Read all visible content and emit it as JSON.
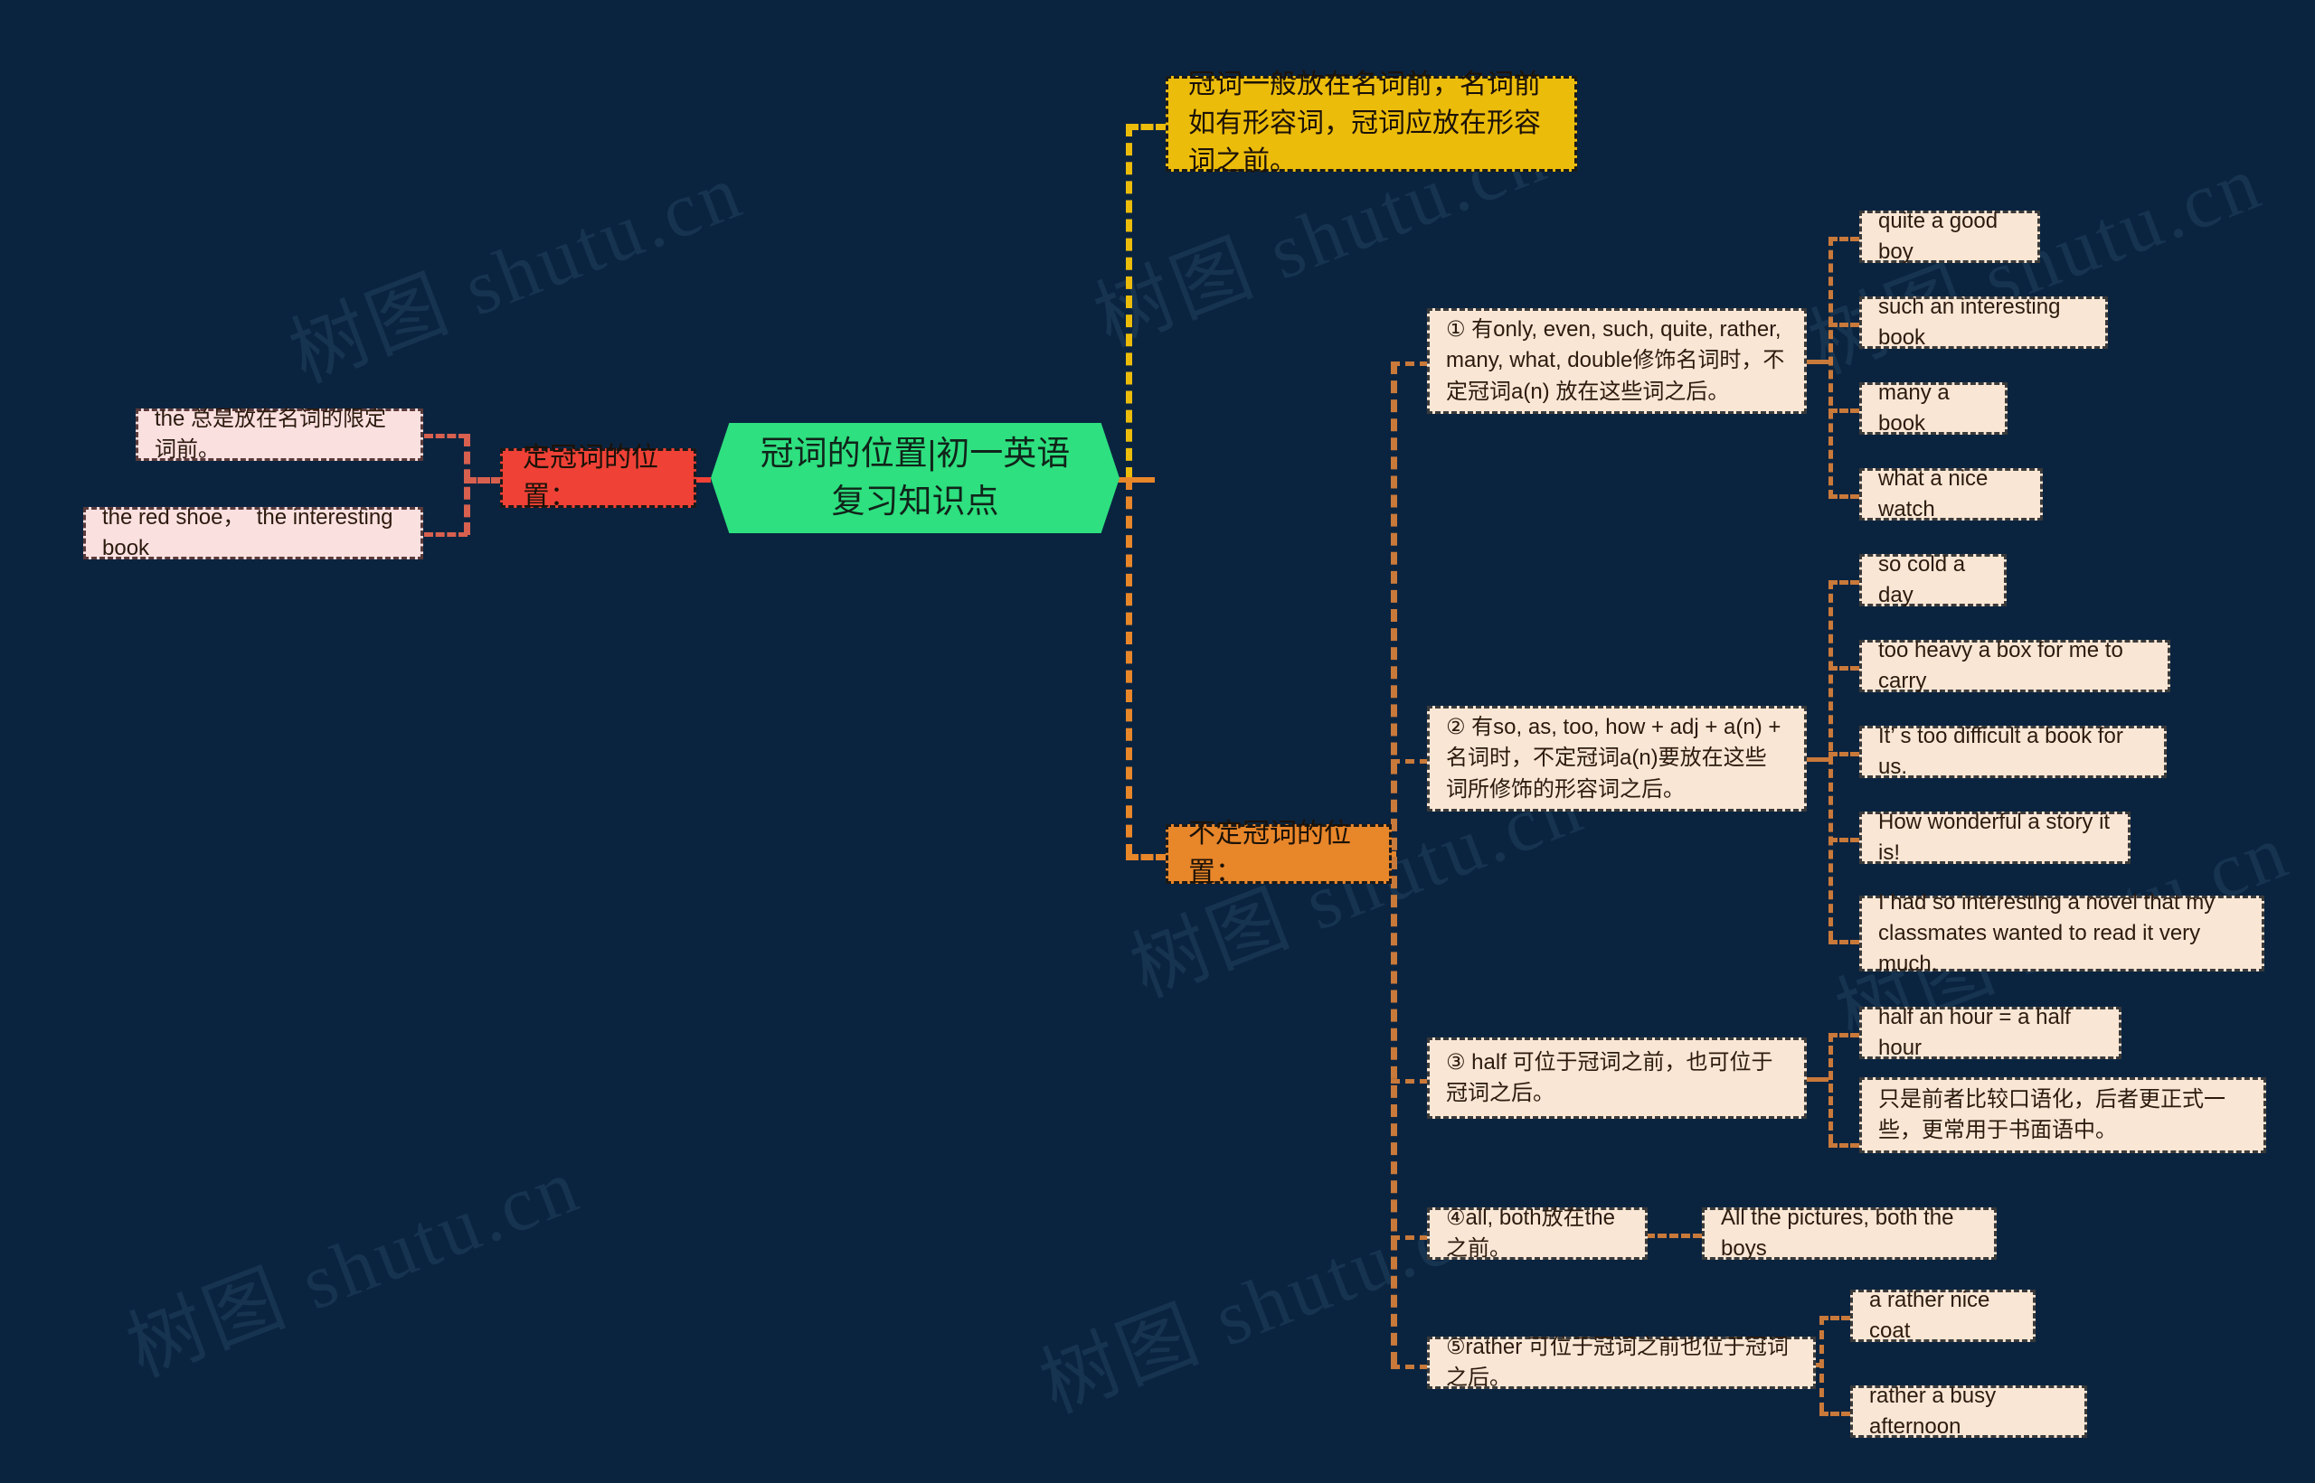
{
  "canvas": {
    "background": "#0a2440",
    "watermark_text": "树图 shutu.cn"
  },
  "colors": {
    "root": "#2ee07f",
    "definite_branch": "#ef4136",
    "general_rule": "#ecbc0b",
    "indefinite_branch": "#e8862a",
    "leaf": "#fae6d4",
    "leaf_pink": "#fbe0e0",
    "background": "#0a2440"
  },
  "root": {
    "label": "冠词的位置|初一英语复习知识点"
  },
  "branches": {
    "definite": {
      "label": "定冠词的位置：",
      "children": [
        {
          "label": "the 总是放在名词的限定词前。"
        },
        {
          "label": "the red shoe，  the interesting book"
        }
      ]
    },
    "general_rule": {
      "label": "冠词一般放在名词前，名词前如有形容词，冠词应放在形容词之前。"
    },
    "indefinite": {
      "label": "不定冠词的位置：",
      "children": [
        {
          "label": "① 有only, even, such, quite, rather, many, what, double修饰名词时，不定冠词a(n) 放在这些词之后。",
          "examples": [
            "quite a good boy",
            "such an interesting book",
            "many a book",
            "what a nice watch"
          ]
        },
        {
          "label": "② 有so, as, too, how + adj + a(n) + 名词时，不定冠词a(n)要放在这些词所修饰的形容词之后。",
          "examples": [
            "so cold a day",
            "too heavy a box for me to carry",
            "It’ s too difficult a book for us.",
            "How wonderful a story it is!",
            "I had so interesting a novel that my classmates wanted to read it very much."
          ]
        },
        {
          "label": "③ half 可位于冠词之前，也可位于冠词之后。",
          "examples": [
            "half an hour = a half hour",
            "只是前者比较口语化，后者更正式一些，更常用于书面语中。"
          ]
        },
        {
          "label": "④all, both放在the 之前。",
          "examples": [
            "All the pictures, both the boys"
          ]
        },
        {
          "label": "⑤rather 可位于冠词之前也位于冠词之后。",
          "examples": [
            "a rather nice coat",
            "rather a busy afternoon"
          ]
        }
      ]
    }
  }
}
